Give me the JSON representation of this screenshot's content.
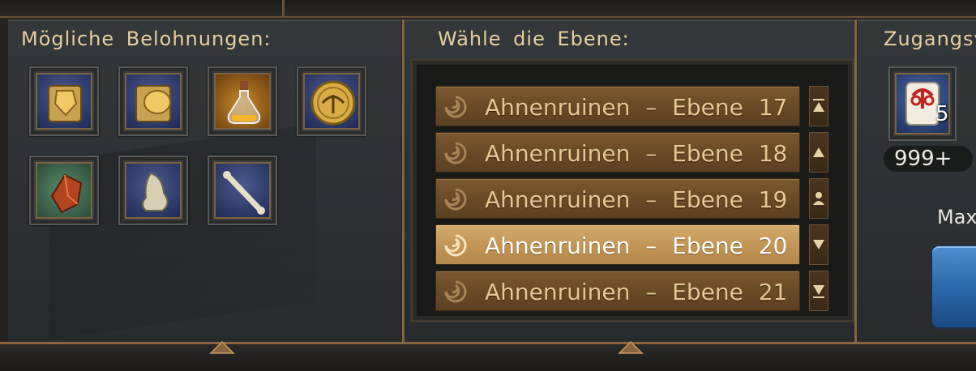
{
  "rewards": {
    "title": "Mögliche Belohnungen:",
    "items": [
      {
        "icon": "scroll-armor-icon"
      },
      {
        "icon": "scroll-gauntlet-icon"
      },
      {
        "icon": "potion-flask-icon",
        "highlight": "gold"
      },
      {
        "icon": "gold-coin-icon"
      },
      {
        "icon": "red-gem-icon",
        "highlight": "green"
      },
      {
        "icon": "bone-nose-icon"
      },
      {
        "icon": "bone-stick-icon"
      }
    ]
  },
  "levels": {
    "title": "Wähle die Ebene:",
    "items": [
      {
        "label": "Ahnenruinen – Ebene 17",
        "selected": false
      },
      {
        "label": "Ahnenruinen – Ebene 18",
        "selected": false
      },
      {
        "label": "Ahnenruinen – Ebene 19",
        "selected": false
      },
      {
        "label": "Ahnenruinen – Ebene 20",
        "selected": true
      },
      {
        "label": "Ahnenruinen – Ebene 21",
        "selected": false
      }
    ],
    "scroll_buttons": [
      "scroll-top-icon",
      "scroll-up-icon",
      "center-player-icon",
      "scroll-down-icon",
      "scroll-bottom-icon"
    ]
  },
  "access": {
    "title": "Zugangsv",
    "item_icon": "red-seal-scroll-icon",
    "item_quantity": "5",
    "count": "999+",
    "max_label": "Max"
  },
  "colors": {
    "accent_gold": "#e7cf9c",
    "row_brown": "#6a4c28",
    "row_selected": "#c29656",
    "button_blue": "#2d6cb0"
  }
}
